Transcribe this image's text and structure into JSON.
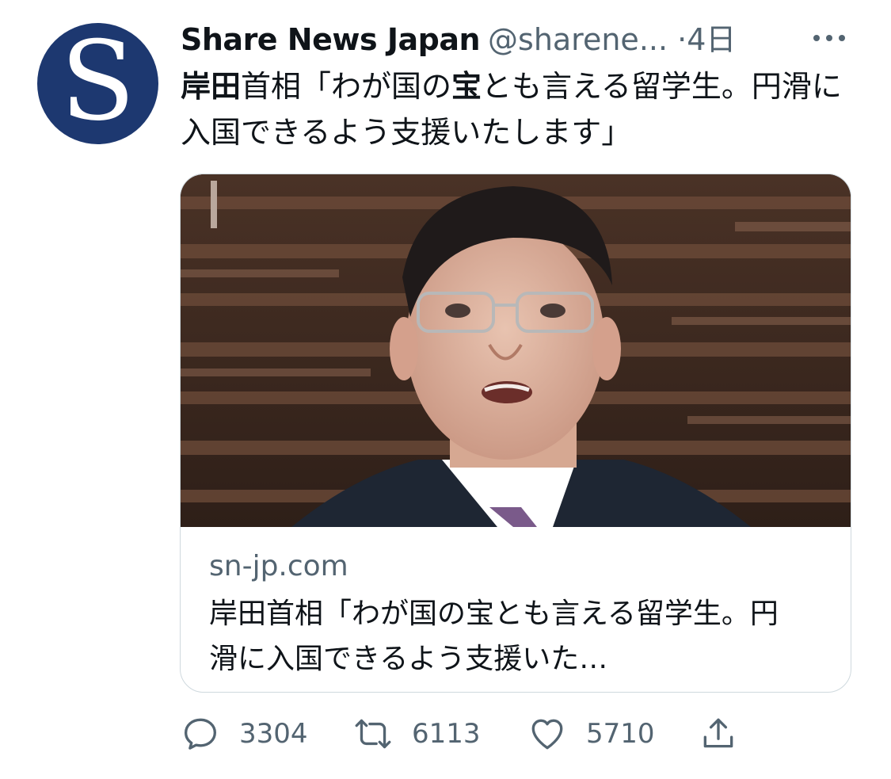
{
  "author": {
    "avatar_letter": "S",
    "display_name": "Share News Japan",
    "handle": "@sharene...",
    "separator": "·",
    "time": "4日"
  },
  "tweet": {
    "text_bold_1": "岸田",
    "text_part_1": "首相「わが国の",
    "text_bold_2": "宝",
    "text_part_2": "とも言える留学生。円滑に入国できるよう支援いたします」"
  },
  "card": {
    "domain": "sn-jp.com",
    "title": "岸田首相「わが国の宝とも言える留学生。円滑に入国できるよう支援いた…"
  },
  "actions": {
    "reply": {
      "icon": "reply-icon",
      "count": "3304"
    },
    "retweet": {
      "icon": "retweet-icon",
      "count": "6113"
    },
    "like": {
      "icon": "heart-icon",
      "count": "5710"
    },
    "share": {
      "icon": "share-icon"
    }
  },
  "colors": {
    "avatar_bg": "#1d3870",
    "secondary_text": "#536471",
    "card_border": "#cfd9de"
  }
}
